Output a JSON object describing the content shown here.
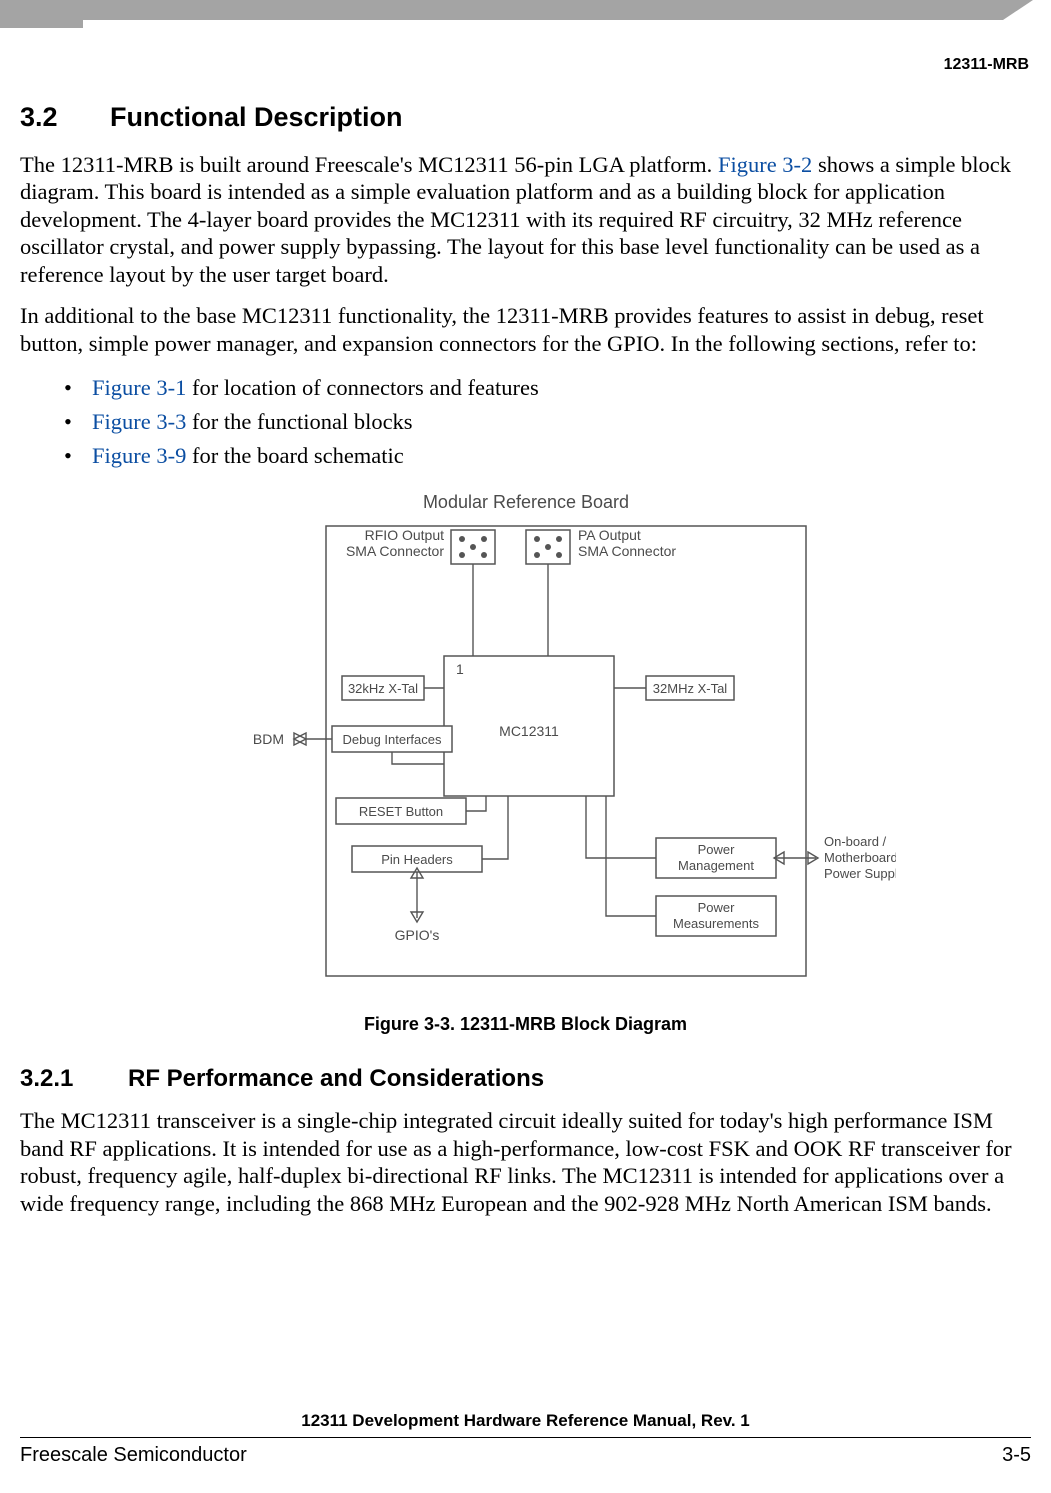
{
  "header": {
    "doc_short": "12311-MRB"
  },
  "section": {
    "number": "3.2",
    "title": "Functional Description",
    "para1_a": "The 12311-MRB is built around Freescale's MC12311 56-pin LGA platform. ",
    "para1_link": "Figure 3-2",
    "para1_b": " shows a simple block diagram. This board is intended as a simple evaluation platform and as a building block for application development. The 4-layer board provides the MC12311 with its required RF circuitry, 32 MHz reference oscillator crystal, and power supply bypassing. The layout for this base level functionality can be used as a reference layout by the user target board.",
    "para2": "In additional to the base MC12311 functionality, the 12311-MRB provides features to assist in debug, reset button, simple power manager, and expansion connectors for the GPIO. In the following sections, refer to:",
    "bullets": [
      {
        "link": "Figure 3-1",
        "rest": " for location of connectors and features"
      },
      {
        "link": "Figure 3-3",
        "rest": " for the functional blocks"
      },
      {
        "link": "Figure 3-9",
        "rest": " for the board schematic"
      }
    ]
  },
  "figure": {
    "caption": "Figure 3-3. 12311-MRB Block Diagram",
    "title": "Modular Reference Board",
    "labels": {
      "rfio1": "RFIO Output",
      "rfio2": "SMA Connector",
      "pa1": "PA Output",
      "pa2": "SMA Connector",
      "xtal32k": "32kHz X-Tal",
      "xtal32m": "32MHz X-Tal",
      "chip_pin": "1",
      "chip": "MC12311",
      "bdm": "BDM",
      "debug": "Debug Interfaces",
      "reset": "RESET Button",
      "pinhdr": "Pin Headers",
      "gpio": "GPIO's",
      "pwr_mgmt1": "Power",
      "pwr_mgmt2": "Management",
      "pwr_meas1": "Power",
      "pwr_meas2": "Measurements",
      "ob1": "On-board /",
      "ob2": "Motherboard",
      "ob3": "Power Supply"
    }
  },
  "subsection": {
    "number": "3.2.1",
    "title": "RF Performance and Considerations",
    "para": "The MC12311 transceiver is a single-chip integrated circuit ideally suited for today's high performance ISM band RF applications. It is intended for use as a high-performance, low-cost FSK and OOK RF transceiver for robust, frequency agile, half-duplex bi-directional RF links. The MC12311 is intended for applications over a wide frequency range, including the 868 MHz European and the 902-928 MHz North American ISM bands."
  },
  "footer": {
    "doc_title": "12311 Development Hardware Reference Manual, Rev. 1",
    "left": "Freescale Semiconductor",
    "right": "3-5"
  }
}
